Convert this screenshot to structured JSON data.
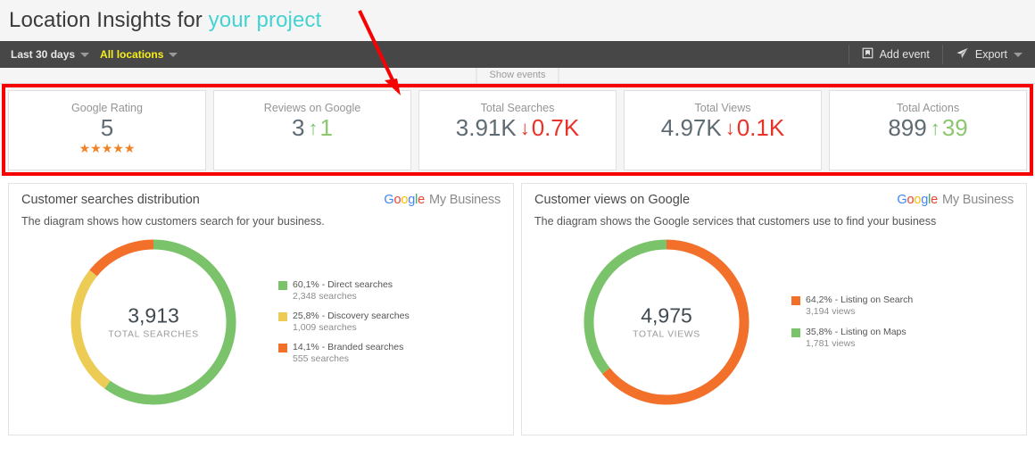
{
  "header": {
    "title_prefix": "Location Insights for ",
    "project_name": "your project"
  },
  "toolbar": {
    "date_range": "Last 30 days",
    "locations": "All locations",
    "add_event": "Add event",
    "export": "Export",
    "add_event_icon": "bookmark-icon",
    "export_icon": "paper-plane-icon",
    "caret_icon": "chevron-down-icon"
  },
  "events_strip": {
    "show_events": "Show events"
  },
  "kpis": [
    {
      "label": "Google Rating",
      "value": "5",
      "delta": "",
      "direction": "none",
      "stars": "★★★★★"
    },
    {
      "label": "Reviews on Google",
      "value": "3",
      "delta": "1",
      "direction": "up",
      "stars": ""
    },
    {
      "label": "Total Searches",
      "value": "3.91K",
      "delta": "0.7K",
      "direction": "down",
      "stars": ""
    },
    {
      "label": "Total Views",
      "value": "4.97K",
      "delta": "0.1K",
      "direction": "down",
      "stars": ""
    },
    {
      "label": "Total Actions",
      "value": "899",
      "delta": "39",
      "direction": "up",
      "stars": ""
    }
  ],
  "panels": [
    {
      "title": "Customer searches distribution",
      "subtitle": "The diagram shows how customers search for your business.",
      "brand": "My Business",
      "total": "3,913",
      "caption": "TOTAL SEARCHES"
    },
    {
      "title": "Customer views on Google",
      "subtitle": "The diagram shows the Google services that customers use to find your business",
      "brand": "My Business",
      "total": "4,975",
      "caption": "TOTAL VIEWS"
    }
  ],
  "colors": {
    "green": "#7ac36a",
    "yellow": "#eccc55",
    "orange": "#f2702a",
    "red": "#e8322a",
    "accent_teal": "#45d2d2",
    "annotation_red": "#f60202",
    "toolbar_bg": "#474747",
    "locations_yellow": "#f5ef1c"
  },
  "chart_data": [
    {
      "type": "pie",
      "title": "Customer searches distribution",
      "subtitle": "The diagram shows how customers search for your business.",
      "center_value": "3,913",
      "center_label": "TOTAL SEARCHES",
      "total": 3913,
      "legend_position": "right",
      "slices": [
        {
          "label": "Direct searches",
          "percent": 60.1,
          "percent_text": "60,1%",
          "value": 2348,
          "value_text": "2,348 searches",
          "color": "#7ac36a"
        },
        {
          "label": "Discovery searches",
          "percent": 25.8,
          "percent_text": "25,8%",
          "value": 1009,
          "value_text": "1,009 searches",
          "color": "#eccc55"
        },
        {
          "label": "Branded searches",
          "percent": 14.1,
          "percent_text": "14,1%",
          "value": 555,
          "value_text": "555 searches",
          "color": "#f2702a"
        }
      ]
    },
    {
      "type": "pie",
      "title": "Customer views on Google",
      "subtitle": "The diagram shows the Google services that customers use to find your business",
      "center_value": "4,975",
      "center_label": "TOTAL VIEWS",
      "total": 4975,
      "legend_position": "right",
      "slices": [
        {
          "label": "Listing on Search",
          "percent": 64.2,
          "percent_text": "64,2%",
          "value": 3194,
          "value_text": "3,194 views",
          "color": "#f2702a"
        },
        {
          "label": "Listing on Maps",
          "percent": 35.8,
          "percent_text": "35,8%",
          "value": 1781,
          "value_text": "1,781 views",
          "color": "#7ac36a"
        }
      ]
    }
  ],
  "legends": {
    "left": [
      {
        "main": "60,1% - Direct searches",
        "sub": "2,348 searches",
        "color": "#7ac36a"
      },
      {
        "main": "25,8% - Discovery searches",
        "sub": "1,009 searches",
        "color": "#eccc55"
      },
      {
        "main": "14,1% - Branded searches",
        "sub": "555 searches",
        "color": "#f2702a"
      }
    ],
    "right": [
      {
        "main": "64,2% - Listing on Search",
        "sub": "3,194 views",
        "color": "#f2702a"
      },
      {
        "main": "35,8% - Listing on Maps",
        "sub": "1,781 views",
        "color": "#7ac36a"
      }
    ]
  }
}
